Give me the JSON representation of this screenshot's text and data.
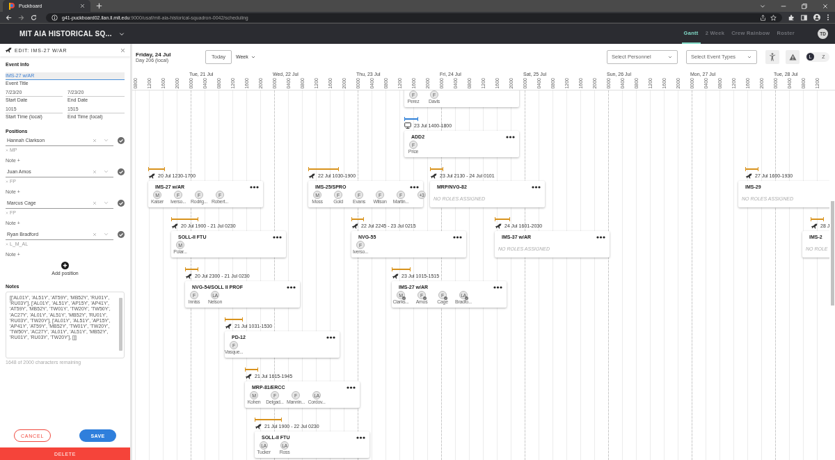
{
  "browser": {
    "tab_title": "Puckboard",
    "url": {
      "host": "g41-puckboard02.llan.ll.mit.edu",
      "path": ":9000/usaf/mit-aia-historical-squadron-0042/scheduling"
    }
  },
  "app_bar": {
    "unit": "MIT AIA HISTORICAL SQ...",
    "nav": [
      {
        "label": "Gantt",
        "selected": true
      },
      {
        "label": "2 Week",
        "selected": false
      },
      {
        "label": "Crew Rainbow",
        "selected": false
      },
      {
        "label": "Roster",
        "selected": false
      }
    ],
    "user_initials": "TD"
  },
  "editor": {
    "title": "EDIT: IMS-27 W/AR",
    "section": "Event Info",
    "fields": [
      {
        "label": "Event Title",
        "value": "IMS-27 w/AR",
        "focused": true
      },
      {
        "label": "Start Date",
        "value": "7/23/20",
        "focused": false
      },
      {
        "label": "End Date",
        "value": "7/23/20",
        "focused": false
      },
      {
        "label": "Start Time (local)",
        "value": "1015",
        "focused": false
      },
      {
        "label": "End Time (local)",
        "value": "1515",
        "focused": false
      }
    ],
    "positions_heading": "Positions",
    "positions": [
      {
        "name": "Hannah Clarkson",
        "role": "MP",
        "note": "Note +",
        "confirmed": true
      },
      {
        "name": "Juan Amos",
        "role": "FP",
        "note": "Note +",
        "confirmed": true
      },
      {
        "name": "Marcus Cage",
        "role": "FP",
        "note": "Note +",
        "confirmed": true
      },
      {
        "name": "Ryan Bradford",
        "role": "L_M_AL",
        "note": "Note +",
        "confirmed": true
      }
    ],
    "add_position": "Add position",
    "notes_heading": "Notes",
    "notes": "[['AL01Y', 'AL51Y', 'AT59Y', 'MB52Y', 'RU01Y', 'RU03Y'], ['AL01Y', 'AL51Y', 'AP15Y', 'AP41Y', 'AT59Y', 'MB52Y', 'TW01Y', 'TW20Y', 'TW50Y', 'AC27Y', 'AL01Y', 'AL51Y', 'MB52Y', 'RU01Y', 'RU03Y', 'TW20Y'], ['AL01Y', 'AL51Y', 'AP15Y', 'AP41Y', 'AT59Y', 'MB52Y', 'TW01Y', 'TW20Y', 'TW50Y', 'AC27Y', 'AL01Y', 'AL51Y', 'MB52Y', 'RU01Y', 'RU03Y', 'TW20Y'], []]",
    "notes_counter": "1648 of 2000 characters remaining",
    "buttons": {
      "cancel": "CANCEL",
      "save": "SAVE",
      "delete": "DELETE"
    }
  },
  "gantt": {
    "date": "Friday, 24 Jul",
    "day": "Day 206 (local)",
    "today": "Today",
    "view": "Week",
    "filters": [
      {
        "placeholder": "Select Personnel"
      },
      {
        "placeholder": "Select Event Types"
      }
    ],
    "time_toggle": [
      {
        "label": "L",
        "selected": true
      },
      {
        "label": "Z",
        "selected": false
      }
    ],
    "days": [
      "Tue, 21 Jul",
      "Wed, 22 Jul",
      "Thu, 23 Jul",
      "Fri, 24 Jul",
      "Sat, 25 Jul",
      "Sun, 26 Jul",
      "Mon, 27 Jul",
      "Tue, 28 Jul"
    ],
    "hours": [
      "0800",
      "1200",
      "1600",
      "2000",
      "0000",
      "0400",
      "0800",
      "1200",
      "1600",
      "2000",
      "0000",
      "0400",
      "0800",
      "1200",
      "1600",
      "2000",
      "0000",
      "0400",
      "0800",
      "1200",
      "1600",
      "2000",
      "0000",
      "0400",
      "0800",
      "1200",
      "1600",
      "2000",
      "0000",
      "0400",
      "0800",
      "1200",
      "1600",
      "2000",
      "0000",
      "0400",
      "0800",
      "1200",
      "1600",
      "2000",
      "0000",
      "0400",
      "0800",
      "1200",
      "1600",
      "2000",
      "0000",
      "0400",
      "0800",
      "1200"
    ],
    "events": [
      {
        "roles": [
          {
            "role": "F",
            "name": "Perez",
            "confirmed": false
          },
          {
            "role": "F",
            "name": "Davis",
            "confirmed": false
          }
        ]
      },
      {
        "kind": "sim",
        "time": "23 Jul 1400-1800",
        "title": "ADD2",
        "roles": [
          {
            "role": "F",
            "name": "Price",
            "confirmed": false
          }
        ]
      },
      {
        "kind": "flight",
        "time": "20 Jul 1230-1700",
        "title": "IMS-27 w/AR",
        "roles": [
          {
            "role": "M",
            "name": "Kaiser",
            "confirmed": false
          },
          {
            "role": "F",
            "name": "Iverso...",
            "confirmed": false
          },
          {
            "role": "F",
            "name": "Rodrig...",
            "confirmed": false
          },
          {
            "role": "F",
            "name": "Robert...",
            "confirmed": false
          }
        ]
      },
      {
        "kind": "flight",
        "time": "22 Jul 1030-1900",
        "title": "IMS-25/SPRO",
        "roles": [
          {
            "role": "M",
            "name": "Moss",
            "confirmed": false
          },
          {
            "role": "F",
            "name": "Gold",
            "confirmed": false
          },
          {
            "role": "F",
            "name": "Evans",
            "confirmed": false
          },
          {
            "role": "F",
            "name": "Wilson",
            "confirmed": false
          },
          {
            "role": "F",
            "name": "Martin...",
            "confirmed": false
          },
          {
            "role": "+3",
            "confirmed": false
          }
        ]
      },
      {
        "kind": "flight",
        "time": "23 Jul 2130 - 24 Jul 0101",
        "title": "MRP/NVG-82",
        "no_roles_text": "NO ROLES ASSIGNED"
      },
      {
        "kind": "flight",
        "time": "27 Jul 1600-1930",
        "title": "IMS-29",
        "no_roles_text": "NO ROLES ASSIGNED"
      },
      {
        "kind": "flight",
        "time": "20 Jul 1900 - 21 Jul 0230",
        "title": "SOLL-II FTU",
        "roles": [
          {
            "role": "M",
            "name": "Polar...",
            "confirmed": false
          }
        ]
      },
      {
        "kind": "flight",
        "time": "22 Jul 2245 - 23 Jul 0215",
        "title": "NVG-55",
        "roles": [
          {
            "role": "F",
            "name": "Iverso...",
            "confirmed": false
          }
        ]
      },
      {
        "kind": "flight",
        "time": "24 Jul 1601-2030",
        "title": "IMS-37 w/AR",
        "no_roles_text": "NO ROLES ASSIGNED"
      },
      {
        "kind": "flight",
        "time": "28 J",
        "title": "IMS-2",
        "no_roles_text": "NO ROLE"
      },
      {
        "kind": "flight",
        "time": "20 Jul 2300 - 21 Jul 0230",
        "title": "NVG-54/SOLL II PROF",
        "roles": [
          {
            "role": "F",
            "name": "Inniss",
            "confirmed": false
          },
          {
            "role": "LA",
            "name": "Nelson",
            "confirmed": false
          }
        ]
      },
      {
        "kind": "flight",
        "time": "23 Jul 1015-1515",
        "title": "IMS-27 w/AR",
        "roles": [
          {
            "role": "M",
            "name": "Clarks...",
            "confirmed": true
          },
          {
            "role": "F",
            "name": "Amos",
            "confirmed": true
          },
          {
            "role": "F",
            "name": "Cage",
            "confirmed": true
          },
          {
            "role": "LA",
            "name": "Bradfo...",
            "confirmed": true
          }
        ]
      },
      {
        "kind": "flight",
        "time": "21 Jul 1031-1530",
        "title": "PD-12",
        "roles": [
          {
            "role": "F",
            "name": "Vasque...",
            "confirmed": false
          }
        ]
      },
      {
        "kind": "flight",
        "time": "21 Jul 1615-1945",
        "title": "MRP-81/ERCC",
        "roles": [
          {
            "role": "M",
            "name": "Kohen",
            "confirmed": false
          },
          {
            "role": "F",
            "name": "Delgad...",
            "confirmed": false
          },
          {
            "role": "F",
            "name": "Mannin...",
            "confirmed": false
          },
          {
            "role": "LA",
            "name": "Cordov...",
            "confirmed": false
          }
        ]
      },
      {
        "kind": "flight",
        "time": "21 Jul 1900 - 22 Jul 0230",
        "title": "SOLL-II FTU",
        "roles": [
          {
            "role": "LA",
            "name": "Tucker",
            "confirmed": false
          },
          {
            "role": "LA",
            "name": "Ross",
            "confirmed": false
          }
        ]
      }
    ]
  }
}
